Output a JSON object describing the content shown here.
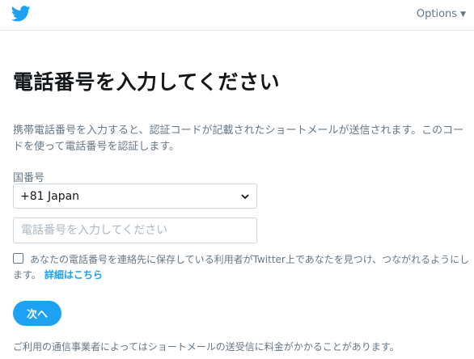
{
  "header": {
    "logo_icon": "twitter-bird-icon",
    "options_label": "Options",
    "options_icon": "caret-down-icon"
  },
  "main": {
    "title": "電話番号を入力してください",
    "description": "携帯電話番号を入力すると、認証コードが記載されたショートメールが送信されます。このコードを使って電話番号を認証します。",
    "country_label": "国番号",
    "country_selected": "+81 Japan",
    "phone_placeholder": "電話番号を入力してください",
    "phone_value": "",
    "checkbox_checked": false,
    "checkbox_text": "あなたの電話番号を連絡先に保存している利用者がTwitter上であなたを見つけ、つながれるようにします。",
    "details_link": "詳細はこちら",
    "next_button": "次へ",
    "footnote": "ご利用の通信事業者によってはショートメールの送受信に料金がかかることがあります。"
  },
  "colors": {
    "accent": "#1da1f2",
    "muted_text": "#657786",
    "border": "#ccd6dd"
  }
}
